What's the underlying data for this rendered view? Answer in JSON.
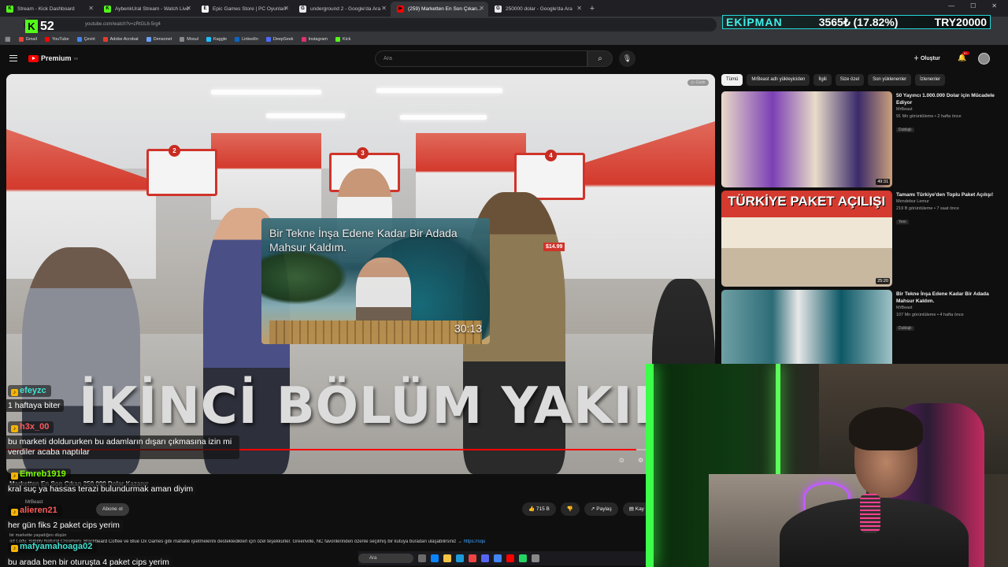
{
  "browser": {
    "tabs": [
      {
        "label": "Stream - Kick Dashboard",
        "fav_color": "#53fc18",
        "fav_glyph": "K"
      },
      {
        "label": "AybenkUral Stream - Watch Live",
        "fav_color": "#53fc18",
        "fav_glyph": "K"
      },
      {
        "label": "Epic Games Store | PC Oyunları",
        "fav_color": "#ffffff",
        "fav_glyph": "E"
      },
      {
        "label": "underground 2 - Google'da Ara",
        "fav_color": "#e8eaed",
        "fav_glyph": "G"
      },
      {
        "label": "(259) Marketten En Son Çıkan...",
        "fav_color": "#ff0000",
        "fav_glyph": "▶"
      },
      {
        "label": "250000 dolar - Google'da Ara",
        "fav_color": "#e8eaed",
        "fav_glyph": "G"
      }
    ],
    "new_tab": "+",
    "url": "youtube.com/watch?v=zRtGL6-5rg4",
    "bookmarks": [
      {
        "label": "Gmail",
        "color": "#ea4335"
      },
      {
        "label": "YouTube",
        "color": "#ff0000"
      },
      {
        "label": "Çeviri",
        "color": "#4285f4"
      },
      {
        "label": "Adobe Acrobat",
        "color": "#e23c2e"
      },
      {
        "label": "Densonet",
        "color": "#6aa0ff"
      },
      {
        "label": "Mosul",
        "color": "#888888"
      },
      {
        "label": "Kaggle",
        "color": "#20beff"
      },
      {
        "label": "LinkedIn",
        "color": "#0a66c2"
      },
      {
        "label": "DeepSeek",
        "color": "#4d6bfe"
      },
      {
        "label": "Instagram",
        "color": "#e1306c"
      },
      {
        "label": "Kick",
        "color": "#53fc18"
      }
    ]
  },
  "kick_badge": {
    "letter": "K",
    "number": "52"
  },
  "ticker": {
    "label": "EKİPMAN",
    "change": "3565₺ (17.82%)",
    "total": "TRY20000"
  },
  "youtube": {
    "logo_text": "Premium",
    "logo_sup": "TR",
    "search_placeholder": "Ara",
    "create_label": "Oluştur",
    "bell_count": "9+"
  },
  "video": {
    "hide_label": "Gizle",
    "endcard_title": "Bir Tekne İnşa Edene Kadar Bir Adada Mahsur Kaldım.",
    "endcard_duration": "30:13",
    "caption": "İKİNCİ BÖLÜM YAKINDA!",
    "progress_fraction": 0.985,
    "aisle_numbers": [
      "2",
      "3",
      "4"
    ],
    "price_tag": "$14.99"
  },
  "below": {
    "title": "Marketten En Son Çıkan 250.000 Dolar Kazanır",
    "channel": "MrBeast",
    "subscribe": "Abone ol",
    "like": "715 B",
    "share": "Paylaş",
    "save": "Kay",
    "desc_sub": "bir markette yaşadığını düşün",
    "description": "ad Lady, Simply Natural Creamery, Blackbeard Coffee ve Blue Ox Games gibi mahalle işletmelerini desteklediklerl için özel teşekkürler. Greenville, NC favorilerinden özenle seçilmiş bir kutuya buradan ulaşabilirsiniz →",
    "desc_link": "https://squ"
  },
  "sidebar": {
    "chips": [
      "Tümü",
      "MrBeast adlı yükleyiciden",
      "İlgili",
      "Size özel",
      "Son yüklenenler",
      "İzlenenler"
    ],
    "recs": [
      {
        "title": "50 Yayıncı 1.000.000 Dolar için Mücadele Ediyor",
        "channel": "MrBeast",
        "meta": "91 Mn görüntüleme • 2 hafta önce",
        "badge": "Dublajlı",
        "duration": "49:31"
      },
      {
        "title": "Tamamı Türkiye'den Toplu Paket Açılışı!",
        "channel": "Mendebur Lemur",
        "meta": "219 B görüntüleme • 7 saat önce",
        "badge": "Yeni",
        "duration": "25:20"
      },
      {
        "title": "Bir Tekne İnşa Edene Kadar Bir Adada Mahsur Kaldım.",
        "channel": "MrBeast",
        "meta": "107 Mn görüntüleme • 4 hafta önce",
        "badge": "Dublajlı",
        "duration": ""
      }
    ],
    "thumb2_text": "TÜRKİYE PAKET AÇILIŞI"
  },
  "chat": [
    {
      "name": "efeyzc",
      "name_color": "#40e0d0",
      "msg": "1 haftaya biter"
    },
    {
      "name": "h3x_00",
      "name_color": "#ff5a5a",
      "msg": "bu marketi doldururken bu adamların dışarı çıkmasına izin mi verdiler acaba naptılar"
    },
    {
      "name": "Emreb1919",
      "name_color": "#7cfc00",
      "msg": "kral suç ya hassas terazi bulundurmak aman diyim"
    },
    {
      "name": "alieren21",
      "name_color": "#ff5a5a",
      "msg": "her gün fiks 2 paket cips yerim"
    },
    {
      "name": "mafyamahoaga02",
      "name_color": "#40e0d0",
      "msg": "bu arada ben bir oturuşta 4 paket cips yerim"
    }
  ],
  "taskbar": {
    "search": "Ara"
  }
}
